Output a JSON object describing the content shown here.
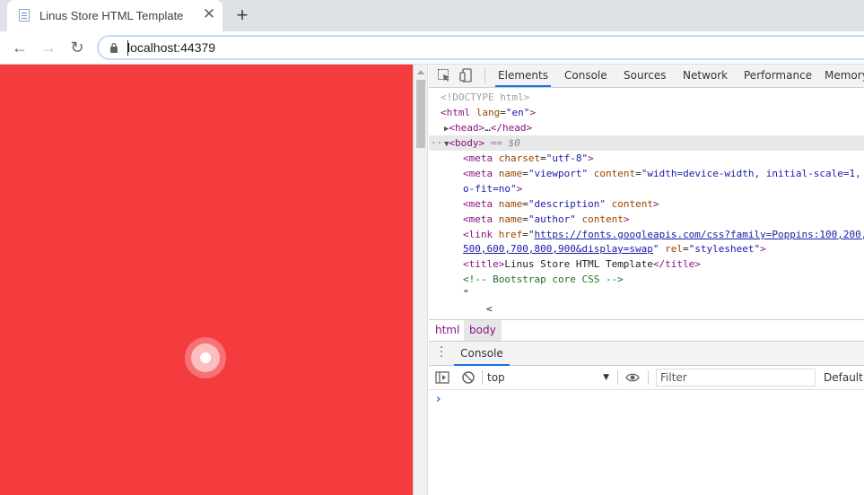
{
  "browser": {
    "tab_title": "Linus Store HTML Template",
    "tab_close": "✕",
    "new_tab": "+",
    "url": "localhost:44379",
    "nav": {
      "back": "←",
      "forward": "→",
      "reload": "↻"
    }
  },
  "page": {
    "background_color": "#f43c3f"
  },
  "devtools": {
    "tabs": [
      "Elements",
      "Console",
      "Sources",
      "Network",
      "Performance",
      "Memory"
    ],
    "active_tab": "Elements",
    "dom": {
      "doctype": "<!DOCTYPE html>",
      "html_open_tag": "<html",
      "html_lang_attr": "lang",
      "html_lang_val": "\"en\"",
      "html_close": ">",
      "head_tag": "<head>",
      "head_ellipsis": "…",
      "head_close": "</head>",
      "body_tag": "<body>",
      "body_marker": "== $0",
      "ellipsis_dots": "···",
      "meta1_open": "<meta",
      "meta1_attr": "charset",
      "meta1_val": "\"utf-8\"",
      "tag_end": ">",
      "meta2_attr1": "name",
      "meta2_val1": "\"viewport\"",
      "meta2_attr2": "content",
      "meta2_val2": "\"width=device-width, initial-scale=1, shrink-t",
      "meta2_cont": "o-fit=no\"",
      "meta3_val1": "\"description\"",
      "meta3_attr2": "content",
      "meta4_val1": "\"author\"",
      "link_open": "<link",
      "link_attr1": "href",
      "link_href_1": "https://fonts.googleapis.com/css?family=Poppins:100,200,300,400,",
      "link_href_2": "500,600,700,800,900&display=swap",
      "link_attr2": "rel",
      "link_val2": "\"stylesheet\"",
      "title_open": "<title>",
      "title_text": "Linus Store HTML Template",
      "title_close": "</title>",
      "comment": "<!-- Bootstrap core CSS -->",
      "quote_char": "\"",
      "lt_char": "<"
    },
    "breadcrumbs": [
      "html",
      "body"
    ],
    "drawer_tab": "Console",
    "console": {
      "context": "top",
      "filter_placeholder": "Filter",
      "levels": "Default levels",
      "prompt": "›"
    }
  }
}
